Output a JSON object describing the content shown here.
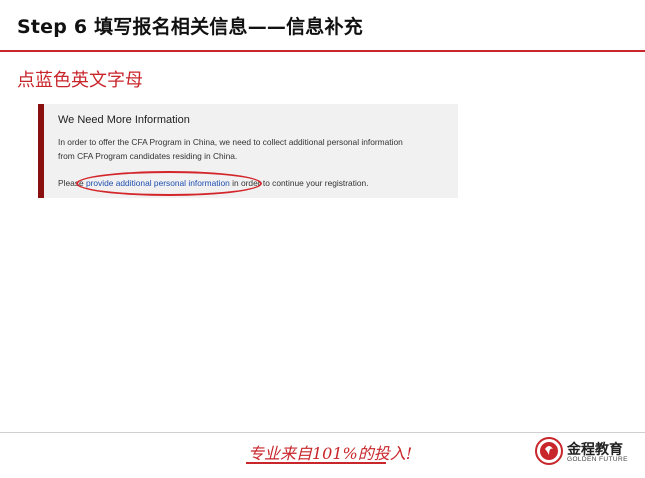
{
  "header": {
    "title": "Step 6 填写报名相关信息——信息补充"
  },
  "instruction": "点蓝色英文字母",
  "panel": {
    "heading": "We Need More Information",
    "line1": "In order to offer the CFA Program in China, we need to collect additional personal information",
    "line2": "from CFA Program candidates residing in China.",
    "prefix": "Please ",
    "link": "provide additional personal information",
    "suffix": " in order to continue your registration."
  },
  "footer": {
    "slogan": "专业来自101%的投入!",
    "brand_cn": "金程教育",
    "brand_en": "GOLDEN FUTURE"
  },
  "colors": {
    "accent": "#c8262b",
    "panel_bar": "#8a1010",
    "link": "#1e4fb0"
  }
}
